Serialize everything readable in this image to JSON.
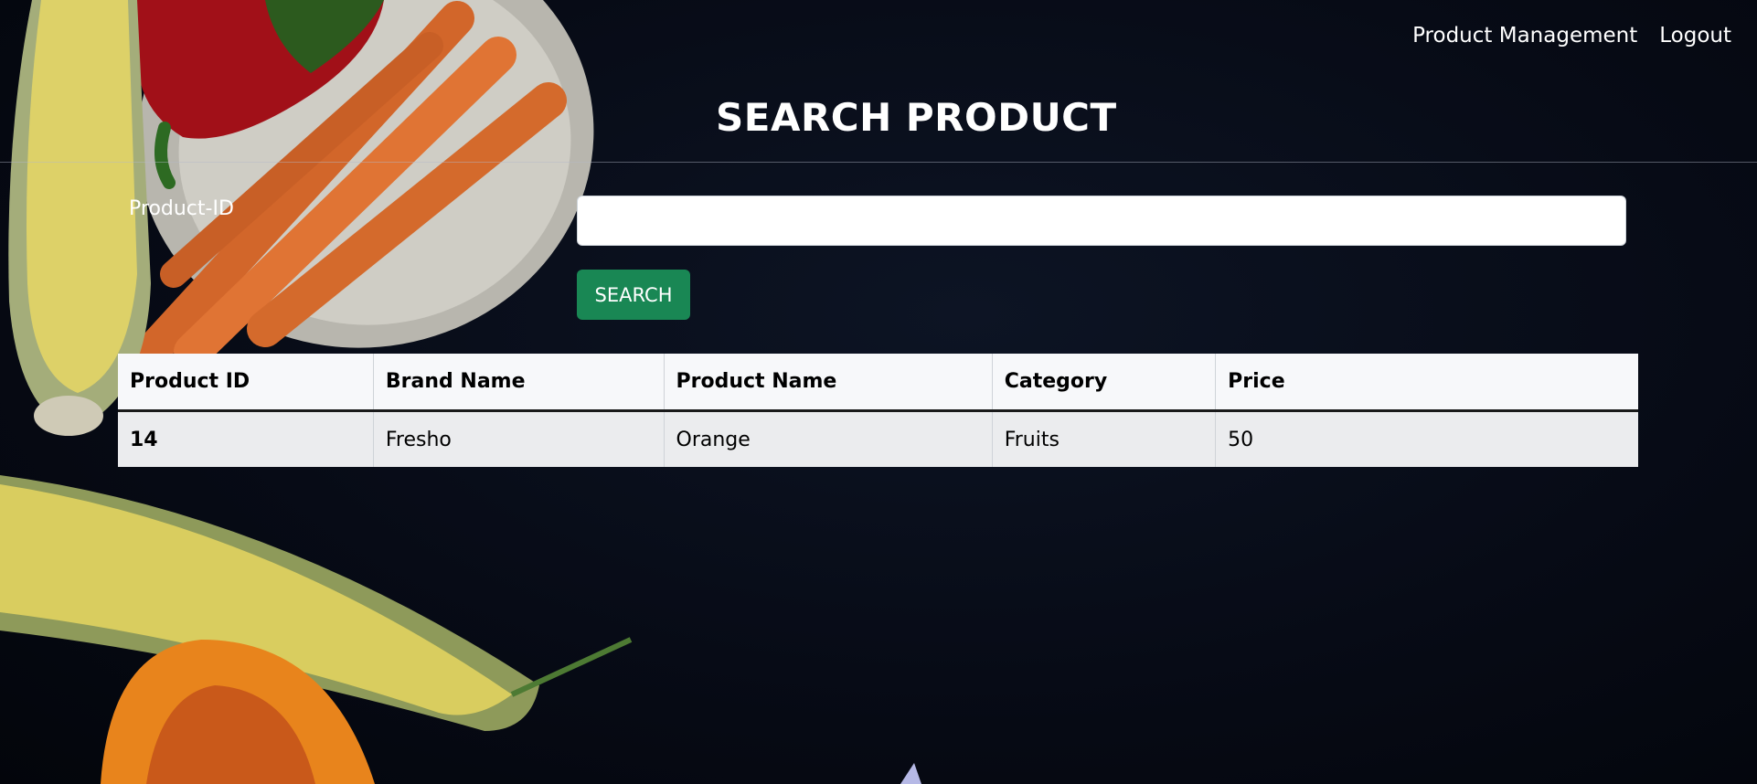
{
  "nav": {
    "items": [
      {
        "label": "Product Management"
      },
      {
        "label": "Logout"
      }
    ]
  },
  "page": {
    "title": "SEARCH PRODUCT"
  },
  "search": {
    "label": "Product-ID",
    "value": "",
    "placeholder": "",
    "button_label": "SEARCH"
  },
  "table": {
    "columns": [
      "Product ID",
      "Brand Name",
      "Product Name",
      "Category",
      "Price"
    ],
    "rows": [
      [
        "14",
        "Fresho",
        "Orange",
        "Fruits",
        "50"
      ]
    ]
  },
  "colors": {
    "background": "#070b16",
    "button": "#198754",
    "table_header": "#f7f8fa",
    "table_row": "#ebecee"
  }
}
